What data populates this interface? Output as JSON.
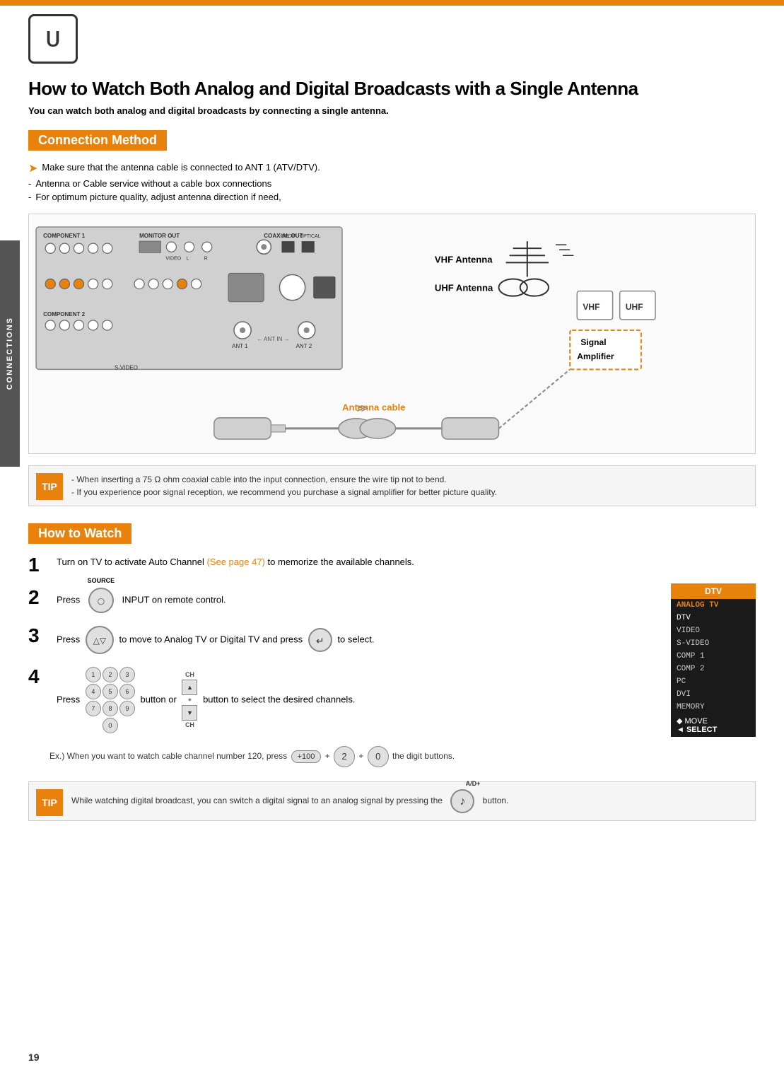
{
  "topBar": {},
  "logo": {
    "symbol": "ᑌ"
  },
  "sidebar": {
    "label": "CONNECTIONS"
  },
  "page": {
    "title": "How to Watch Both Analog and Digital Broadcasts with a Single Antenna",
    "subtitle": "You can watch both analog and digital broadcasts by connecting a single antenna.",
    "connectionSection": {
      "header": "Connection Method",
      "bullets": [
        {
          "type": "arrow",
          "text": "Make sure that the antenna cable is connected to ANT 1 (ATV/DTV)."
        },
        {
          "type": "dash",
          "text": "Antenna or Cable service without a cable box connections"
        },
        {
          "type": "dash",
          "text": "For optimum picture quality, adjust antenna direction if need,"
        }
      ],
      "diagram": {
        "vhfLabel": "VHF Antenna",
        "uhfLabel": "UHF Antenna",
        "vhfText": "VHF",
        "uhfText": "UHF",
        "signalAmpLabel": "Signal\nAmplifier",
        "antennaCableLabel": "Antenna cable"
      }
    },
    "tip1": {
      "badge": "TIP",
      "lines": [
        "- When inserting a 75 Ω ohm coaxial cable into the input connection, ensure the wire tip not to bend.",
        "- If you experience poor signal reception, we recommend you purchase a signal amplifier for better picture quality."
      ]
    },
    "howSection": {
      "header": "How to Watch",
      "steps": [
        {
          "number": "1",
          "text": "Turn on TV to activate Auto Channel",
          "link": "(See page 47)",
          "textAfter": " to memorize the available channels."
        },
        {
          "number": "2",
          "sourceLabel": "SOURCE",
          "text": "Press",
          "textAfter": "INPUT on remote control."
        },
        {
          "number": "3",
          "text": "Press",
          "textMid": "to move to Analog TV or Digital TV and press",
          "textAfter": "to select."
        },
        {
          "number": "4",
          "text": "Press",
          "textMid": "button or",
          "textAfter": "button to select the desired channels."
        }
      ],
      "example": {
        "text": "Ex.) When you want to watch cable channel number 120, press",
        "textAfter": "the digit buttons."
      },
      "dtvPanel": {
        "header": "DTV",
        "items": [
          {
            "label": "ANALOG TV",
            "active": false
          },
          {
            "label": "DTV",
            "active": true
          },
          {
            "label": "VIDEO",
            "active": false
          },
          {
            "label": "S-VIDEO",
            "active": false
          },
          {
            "label": "COMP 1",
            "active": false
          },
          {
            "label": "COMP 2",
            "active": false
          },
          {
            "label": "PC",
            "active": false
          },
          {
            "label": "DVI",
            "active": false
          },
          {
            "label": "MEMORY",
            "active": false
          }
        ],
        "move": "◆ MOVE",
        "select": "◄ SELECT"
      }
    },
    "tip2": {
      "badge": "TIP",
      "adLabel": "A/D+",
      "text": "While watching digital broadcast, you can switch a digital signal to an analog signal by pressing the",
      "textAfter": "button."
    },
    "pageNumber": "19"
  }
}
